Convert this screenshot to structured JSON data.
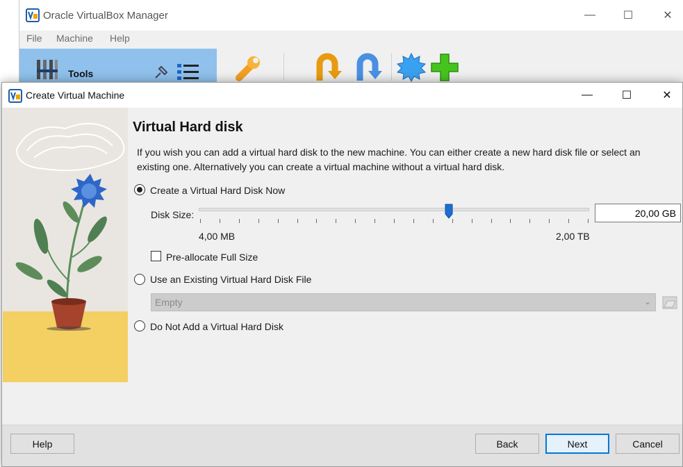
{
  "manager": {
    "title": "Oracle VirtualBox Manager",
    "menu": [
      "File",
      "Machine",
      "Help"
    ],
    "tools_label": "Tools",
    "window_buttons": {
      "minimize": "—",
      "maximize": "☐",
      "close": "✕"
    }
  },
  "dialog": {
    "title": "Create Virtual Machine",
    "window_buttons": {
      "minimize": "—",
      "maximize": "☐",
      "close": "✕"
    },
    "heading": "Virtual Hard disk",
    "description": "If you wish you can add a virtual hard disk to the new machine. You can either create a new hard disk file or select an existing one. Alternatively you can create a virtual machine without a virtual hard disk.",
    "options": {
      "create_now": {
        "label": "Create a Virtual Hard Disk Now",
        "selected": true
      },
      "use_existing": {
        "label": "Use an Existing Virtual Hard Disk File",
        "selected": false
      },
      "do_not_add": {
        "label": "Do Not Add a Virtual Hard Disk",
        "selected": false
      }
    },
    "disk_size": {
      "label": "Disk Size:",
      "value": "20,00 GB",
      "min_label": "4,00 MB",
      "max_label": "2,00 TB",
      "slider_fraction": 0.64
    },
    "preallocate": {
      "label": "Pre-allocate Full Size",
      "checked": false
    },
    "existing_file": {
      "selected": "Empty"
    },
    "buttons": {
      "help": "Help",
      "back": "Back",
      "next": "Next",
      "cancel": "Cancel"
    }
  },
  "colors": {
    "accent": "#0078d7",
    "tools_bg": "#8fc1ec",
    "slider_handle": "#1c6fd1",
    "illustration_ground": "#f4cf62"
  }
}
